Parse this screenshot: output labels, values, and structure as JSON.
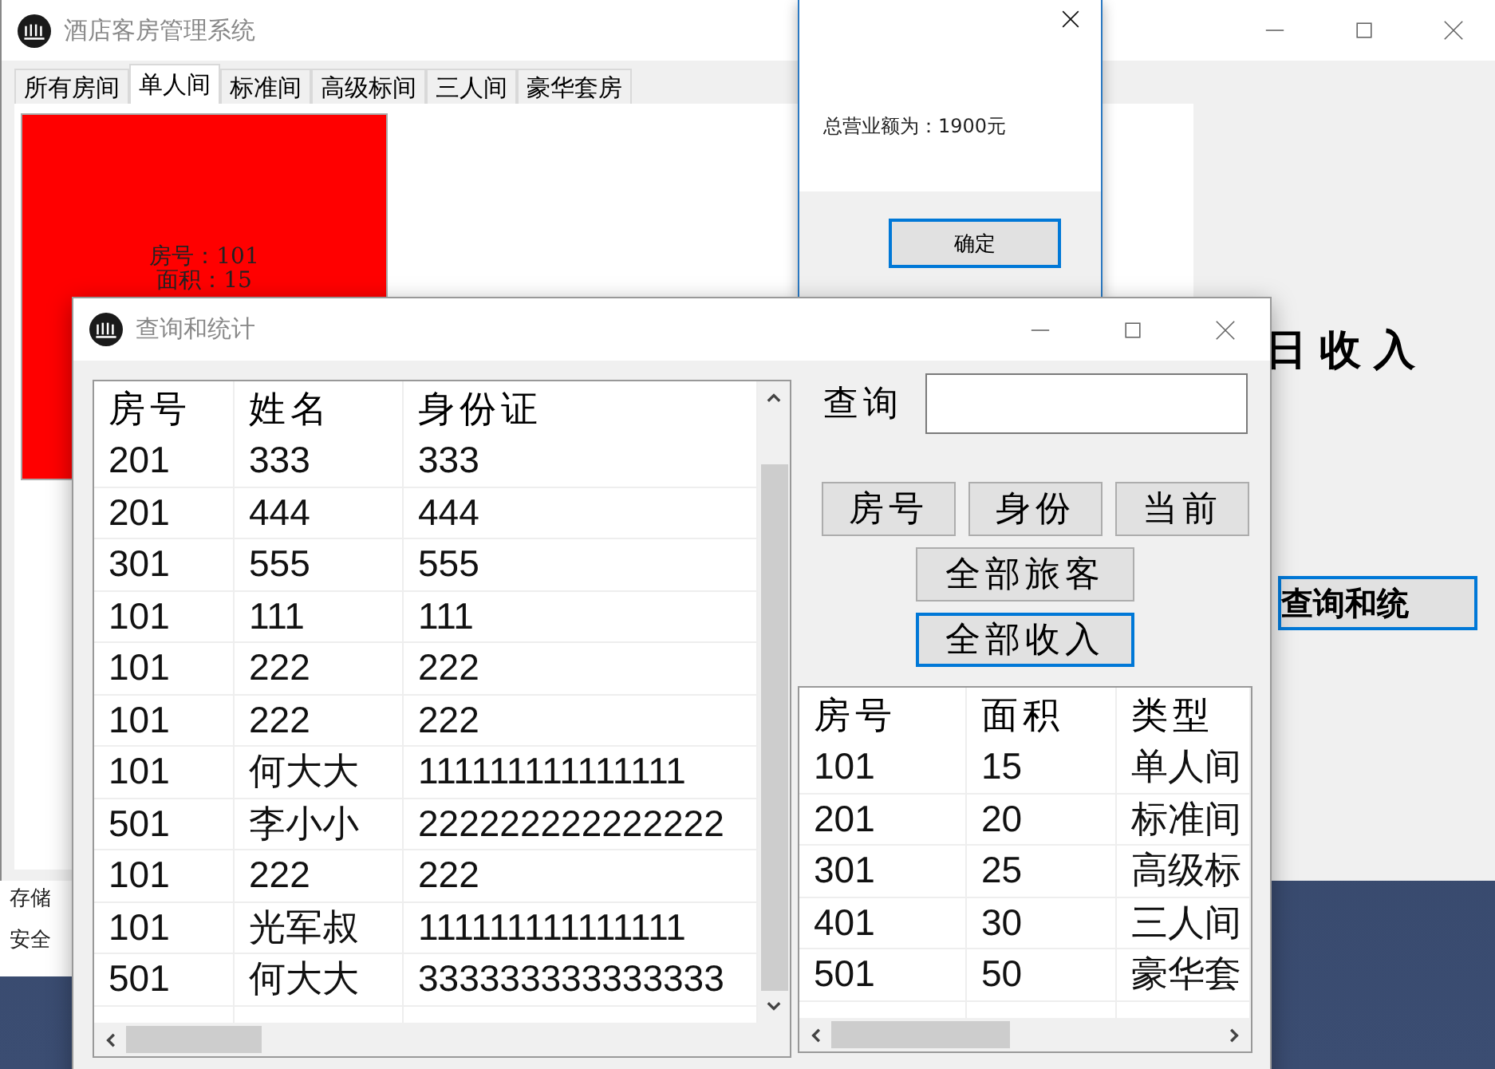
{
  "main_window": {
    "title": "酒店客房管理系统",
    "tabs": [
      {
        "label": "所有房间",
        "selected": false
      },
      {
        "label": "单人间",
        "selected": true
      },
      {
        "label": "标准间",
        "selected": false
      },
      {
        "label": "高级标间",
        "selected": false
      },
      {
        "label": "三人间",
        "selected": false
      },
      {
        "label": "豪华套房",
        "selected": false
      }
    ],
    "room_card": {
      "lines": [
        "房号：101",
        "面积：15"
      ]
    },
    "income_label": "日收入",
    "stats_button": {
      "label": "查询和统",
      "focused": true
    }
  },
  "background_window": {
    "items": [
      "存储",
      "安全"
    ]
  },
  "message_box": {
    "message": "总营业额为：1900元",
    "ok_button": {
      "label": "确定",
      "focused": true
    }
  },
  "query_window": {
    "title": "查询和统计",
    "guest_table": {
      "columns": [
        "房号",
        "姓名",
        "身份证"
      ],
      "rows": [
        [
          "201",
          "333",
          "333"
        ],
        [
          "201",
          "444",
          "444"
        ],
        [
          "301",
          "555",
          "555"
        ],
        [
          "101",
          "111",
          "111"
        ],
        [
          "101",
          "222",
          "222"
        ],
        [
          "101",
          "222",
          "222"
        ],
        [
          "101",
          "何大大",
          "111111111111111"
        ],
        [
          "501",
          "李小小",
          "222222222222222"
        ],
        [
          "101",
          "222",
          "222"
        ],
        [
          "101",
          "光军叔",
          "111111111111111"
        ],
        [
          "501",
          "何大大",
          "333333333333333"
        ]
      ]
    },
    "search_label": "查询",
    "filter_buttons": [
      {
        "label": "房号",
        "focused": false
      },
      {
        "label": "身份",
        "focused": false
      },
      {
        "label": "当前",
        "focused": false
      }
    ],
    "action_buttons": [
      {
        "label": "全部旅客",
        "focused": false
      },
      {
        "label": "全部收入",
        "focused": true
      }
    ],
    "room_table": {
      "columns": [
        "房号",
        "面积",
        "类型"
      ],
      "rows": [
        [
          "101",
          "15",
          "单人间"
        ],
        [
          "201",
          "20",
          "标准间"
        ],
        [
          "301",
          "25",
          "高级标"
        ],
        [
          "401",
          "30",
          "三人间"
        ],
        [
          "501",
          "50",
          "豪华套"
        ]
      ]
    }
  }
}
